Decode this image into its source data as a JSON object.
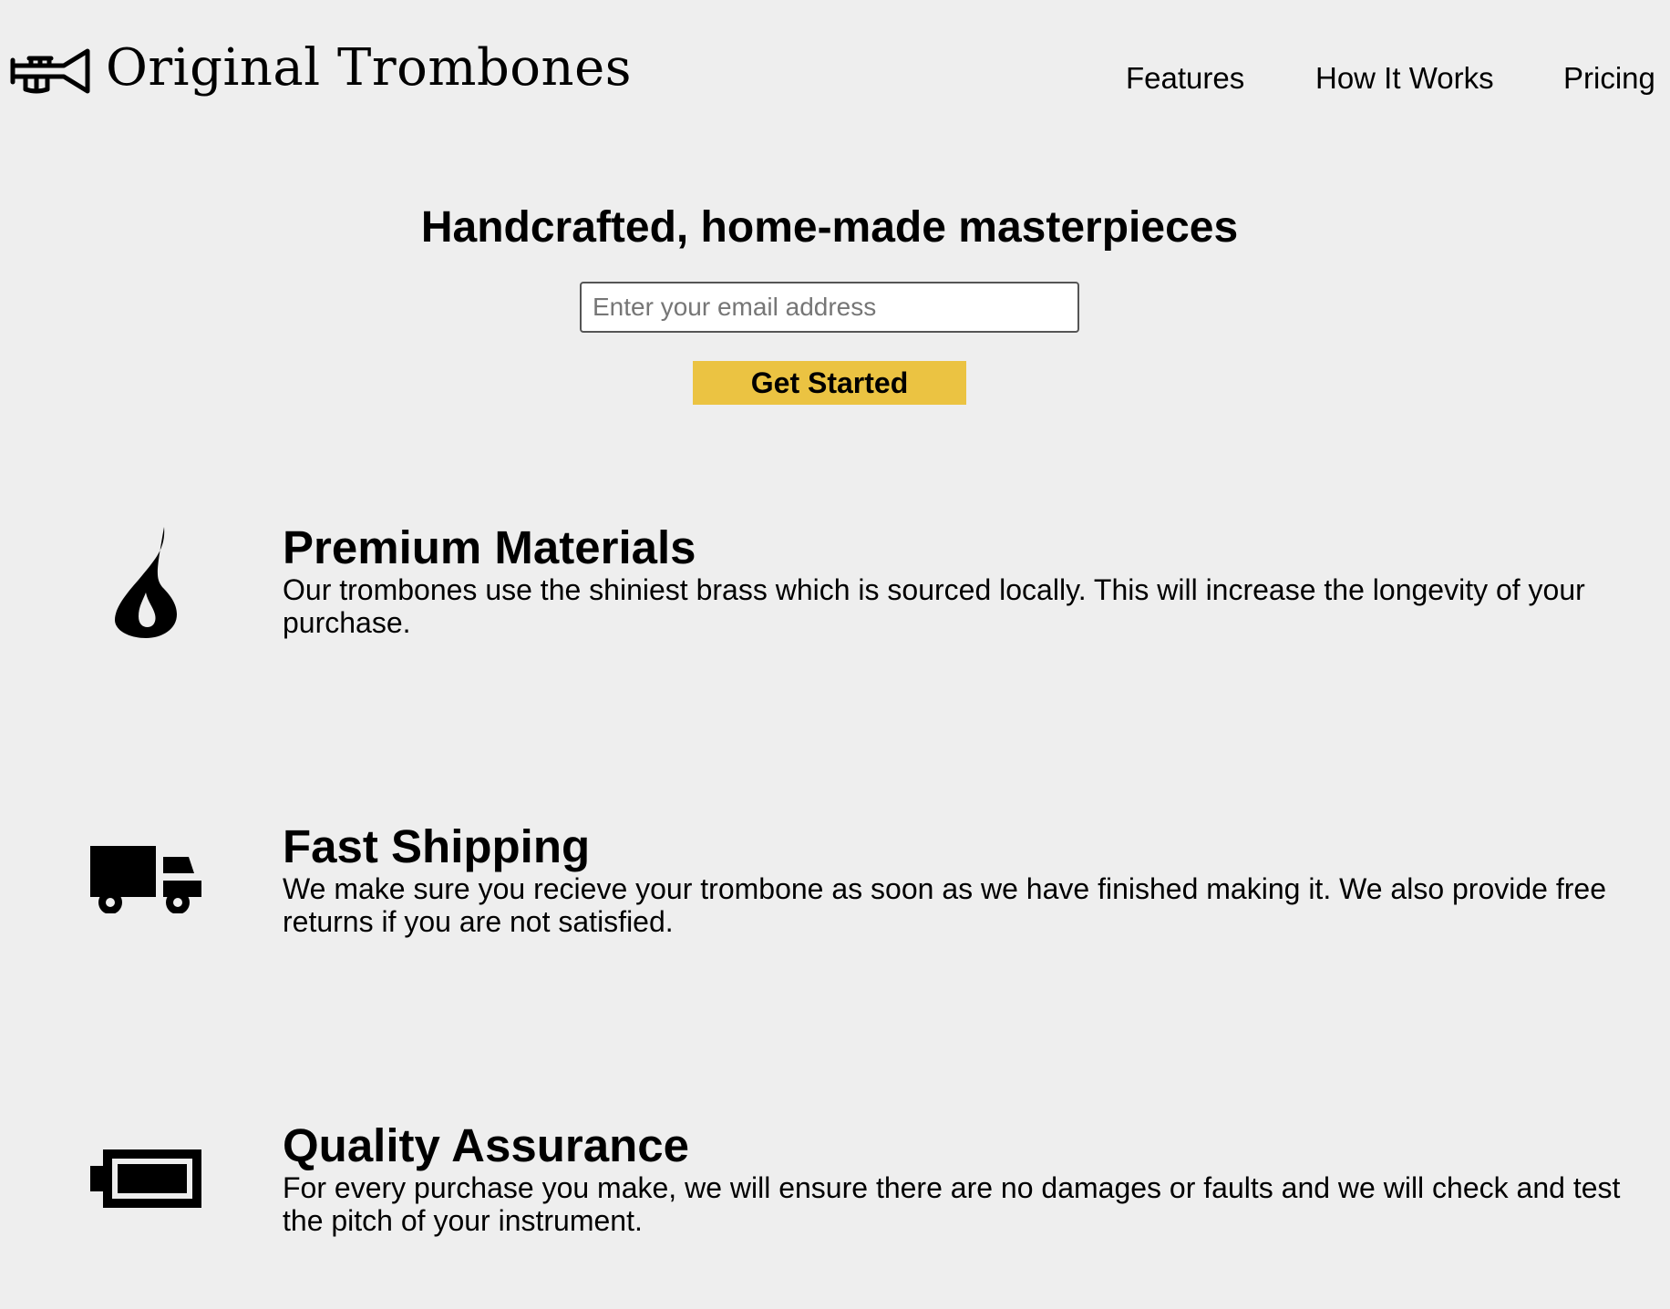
{
  "header": {
    "brand": "Original Trombones",
    "logo_icon": "trumpet-logo-icon",
    "nav": [
      "Features",
      "How It Works",
      "Pricing"
    ]
  },
  "hero": {
    "title": "Handcrafted, home-made masterpieces",
    "email_placeholder": "Enter your email address",
    "email_value": "",
    "cta_label": "Get Started",
    "cta_color": "#ebc342"
  },
  "features": [
    {
      "icon": "fire-icon",
      "title": "Premium Materials",
      "description": "Our trombones use the shiniest brass which is sourced locally. This will increase the longevity of your purchase."
    },
    {
      "icon": "truck-icon",
      "title": "Fast Shipping",
      "description": "We make sure you recieve your trombone as soon as we have finished making it. We also provide free returns if you are not satisfied."
    },
    {
      "icon": "battery-icon",
      "title": "Quality Assurance",
      "description": "For every purchase you make, we will ensure there are no damages or faults and we will check and test the pitch of your instrument."
    }
  ]
}
